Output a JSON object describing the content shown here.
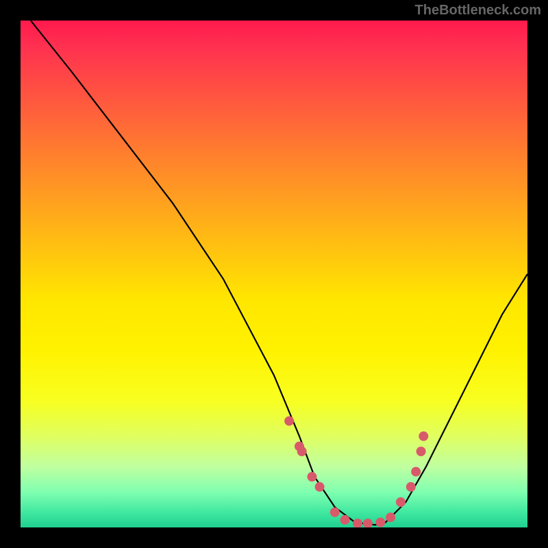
{
  "watermark": "TheBottleneck.com",
  "chart_data": {
    "type": "line",
    "title": "",
    "xlabel": "",
    "ylabel": "",
    "xlim": [
      0,
      100
    ],
    "ylim": [
      0,
      100
    ],
    "series": [
      {
        "name": "bottleneck-curve",
        "x": [
          2,
          10,
          20,
          30,
          40,
          50,
          55,
          58,
          62,
          66,
          70,
          72,
          76,
          80,
          85,
          90,
          95,
          100
        ],
        "y": [
          100,
          90,
          77,
          64,
          49,
          30,
          18,
          10,
          4,
          1,
          0.5,
          1,
          5,
          12,
          22,
          32,
          42,
          50
        ]
      }
    ],
    "markers": {
      "name": "highlight-dots",
      "x": [
        53,
        55,
        55.5,
        57.5,
        59,
        62,
        64,
        66.5,
        68.5,
        71,
        73,
        75,
        77,
        78,
        79,
        79.5
      ],
      "y": [
        21,
        16,
        15,
        10,
        8,
        3,
        1.5,
        0.8,
        0.8,
        1,
        2,
        5,
        8,
        11,
        15,
        18
      ]
    },
    "gradient": {
      "stops": [
        {
          "pos": 0,
          "color": "#ff1a4d"
        },
        {
          "pos": 55,
          "color": "#ffe600"
        },
        {
          "pos": 100,
          "color": "#20d090"
        }
      ]
    }
  }
}
